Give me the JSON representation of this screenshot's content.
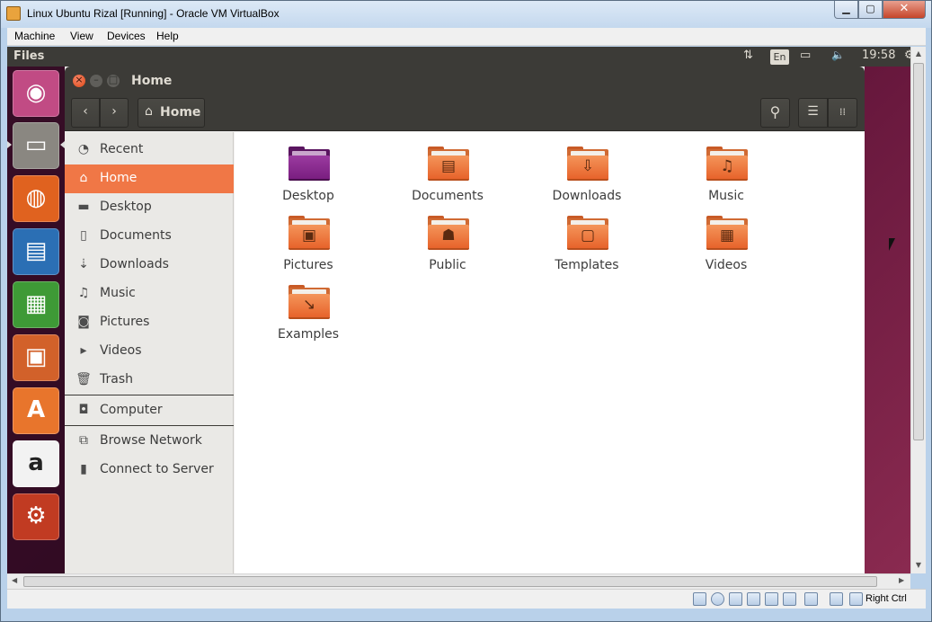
{
  "host": {
    "title": "Linux Ubuntu Rizal [Running] - Oracle VM VirtualBox",
    "menu": [
      "Machine",
      "View",
      "Devices",
      "Help"
    ],
    "controls": {
      "minimize": "▁",
      "maximize": "▢",
      "close": "✕"
    },
    "status": {
      "host_key": "Right Ctrl"
    }
  },
  "panel": {
    "app_name": "Files",
    "lang": "En",
    "time": "19:58",
    "network_glyph": "⇅",
    "battery_glyph": "▭",
    "volume_glyph": "🔈",
    "power_glyph": "⚙"
  },
  "launcher": {
    "items": [
      {
        "name": "ubuntu-dash",
        "glyph": "◉",
        "color": "#c14b84"
      },
      {
        "name": "files",
        "glyph": "▭",
        "color": "#8a8781"
      },
      {
        "name": "firefox",
        "glyph": "◍",
        "color": "#e0621f"
      },
      {
        "name": "writer",
        "glyph": "▤",
        "color": "#2b6fb4"
      },
      {
        "name": "calc",
        "glyph": "▦",
        "color": "#3e9a36"
      },
      {
        "name": "impress",
        "glyph": "▣",
        "color": "#d2612a"
      },
      {
        "name": "software-center",
        "glyph": "A",
        "color": "#e8752c"
      },
      {
        "name": "amazon",
        "glyph": "a",
        "color": "#f2f2f2"
      },
      {
        "name": "system-settings",
        "glyph": "⚙",
        "color": "#c13b22"
      }
    ]
  },
  "nautilus": {
    "window_title": "Home",
    "breadcrumb": "Home",
    "nav": {
      "back": "‹",
      "forward": "›"
    },
    "toolbar": {
      "search": "⚲",
      "list_view": "☰",
      "grid_view": "⁞⁞"
    },
    "sidebar": [
      {
        "icon": "◔",
        "label": "Recent",
        "icon_name": "clock-icon"
      },
      {
        "icon": "⌂",
        "label": "Home",
        "icon_name": "home-icon",
        "active": true
      },
      {
        "icon": "▬",
        "label": "Desktop",
        "icon_name": "desktop-folder-icon"
      },
      {
        "icon": "▯",
        "label": "Documents",
        "icon_name": "document-icon"
      },
      {
        "icon": "⇣",
        "label": "Downloads",
        "icon_name": "download-icon"
      },
      {
        "icon": "♫",
        "label": "Music",
        "icon_name": "music-icon"
      },
      {
        "icon": "◙",
        "label": "Pictures",
        "icon_name": "camera-icon"
      },
      {
        "icon": "▸",
        "label": "Videos",
        "icon_name": "video-icon"
      },
      {
        "icon": "🗑",
        "label": "Trash",
        "icon_name": "trash-icon"
      },
      {
        "icon": "◘",
        "label": "Computer",
        "icon_name": "computer-icon"
      },
      {
        "icon": "⧉",
        "label": "Browse Network",
        "icon_name": "network-icon"
      },
      {
        "icon": "▮",
        "label": "Connect to Server",
        "icon_name": "server-icon"
      }
    ],
    "files": [
      {
        "label": "Desktop",
        "emblem": "",
        "kind": "desktop"
      },
      {
        "label": "Documents",
        "emblem": "▤",
        "kind": "folder"
      },
      {
        "label": "Downloads",
        "emblem": "⇩",
        "kind": "folder"
      },
      {
        "label": "Music",
        "emblem": "♫",
        "kind": "folder"
      },
      {
        "label": "Pictures",
        "emblem": "▣",
        "kind": "folder"
      },
      {
        "label": "Public",
        "emblem": "☗",
        "kind": "folder"
      },
      {
        "label": "Templates",
        "emblem": "▢",
        "kind": "folder"
      },
      {
        "label": "Videos",
        "emblem": "▦",
        "kind": "folder"
      },
      {
        "label": "Examples",
        "emblem": "↘",
        "kind": "folder"
      }
    ]
  },
  "colors": {
    "accent": "#f07746",
    "panel": "#3c3b37",
    "wallpaper": "#5b1136"
  }
}
